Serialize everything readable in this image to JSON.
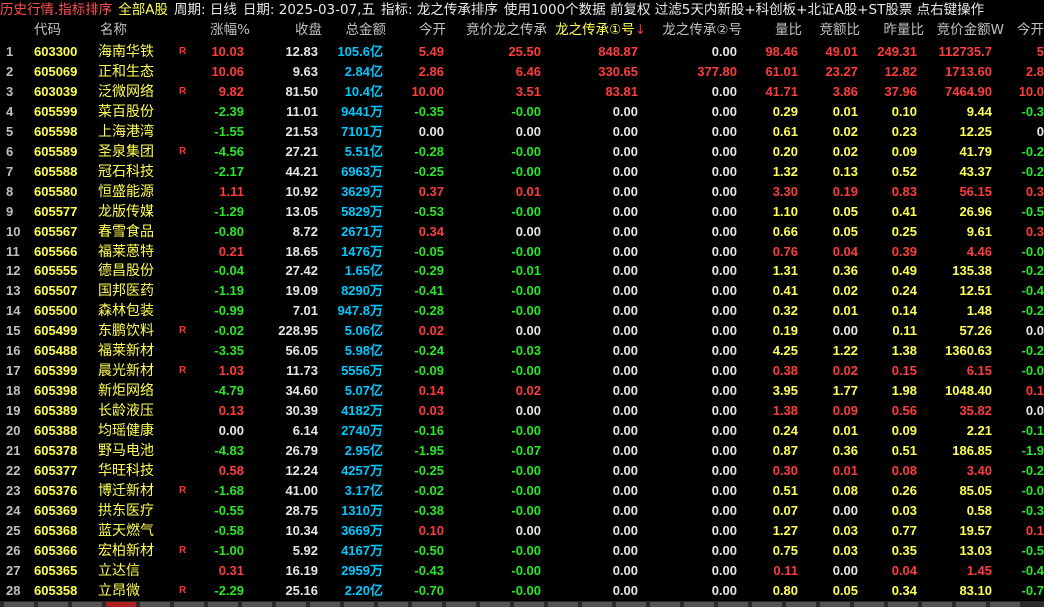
{
  "topbar": [
    {
      "text": "历史行情.指标排序",
      "color": "title"
    },
    {
      "text": "全部A股",
      "color": "y"
    },
    {
      "text": "周期: 日线",
      "color": "w"
    },
    {
      "text": "日期: 2025-03-07,五",
      "color": "w"
    },
    {
      "text": "指标: 龙之传承排序",
      "color": "w"
    },
    {
      "text": "使用1000个数据 前复权 过滤5天内新股+科创板+北证A股+ST股票 点右键操作",
      "color": "w"
    }
  ],
  "columns": [
    "",
    "代码",
    "名称",
    "涨幅%",
    "收盘",
    "总金额",
    "今开",
    "竞价龙之传承",
    "龙之传承①号",
    "龙之传承②号",
    "量比",
    "竞额比",
    "昨量比",
    "竞价金额W",
    "今开"
  ],
  "sorted_arrow": "↓",
  "rows": [
    {
      "seq": "1",
      "code": "603300",
      "name": "海南华铁",
      "flag": "R",
      "chg": "10.03",
      "close": "12.83",
      "amt": "105.6亿",
      "open": "5.49",
      "bid": "25.50",
      "l1": "848.87",
      "l2": "0.00",
      "vr": "98.46",
      "bar": "49.01",
      "yvr": "249.31",
      "bamt": "112735.7",
      "open2": "5"
    },
    {
      "seq": "2",
      "code": "605069",
      "name": "正和生态",
      "flag": "",
      "chg": "10.06",
      "close": "9.63",
      "amt": "2.84亿",
      "open": "2.86",
      "bid": "6.46",
      "l1": "330.65",
      "l2": "377.80",
      "vr": "61.01",
      "bar": "23.27",
      "yvr": "12.82",
      "bamt": "1713.60",
      "open2": "2.8"
    },
    {
      "seq": "3",
      "code": "603039",
      "name": "泛微网络",
      "flag": "R",
      "chg": "9.82",
      "close": "81.50",
      "amt": "10.4亿",
      "open": "10.00",
      "bid": "3.51",
      "l1": "83.81",
      "l2": "0.00",
      "vr": "41.71",
      "bar": "3.86",
      "yvr": "37.96",
      "bamt": "7464.90",
      "open2": "10.0"
    },
    {
      "seq": "4",
      "code": "605599",
      "name": "菜百股份",
      "flag": "",
      "chg": "-2.39",
      "close": "11.01",
      "amt": "9441万",
      "open": "-0.35",
      "bid": "-0.00",
      "l1": "0.00",
      "l2": "0.00",
      "vr": "0.29",
      "bar": "0.01",
      "yvr": "0.10",
      "bamt": "9.44",
      "open2": "-0.3"
    },
    {
      "seq": "5",
      "code": "605598",
      "name": "上海港湾",
      "flag": "",
      "chg": "-1.55",
      "close": "21.53",
      "amt": "7101万",
      "open": "0.00",
      "bid": "0.00",
      "l1": "0.00",
      "l2": "0.00",
      "vr": "0.61",
      "bar": "0.02",
      "yvr": "0.23",
      "bamt": "12.25",
      "open2": "0"
    },
    {
      "seq": "6",
      "code": "605589",
      "name": "圣泉集团",
      "flag": "R",
      "chg": "-4.56",
      "close": "27.21",
      "amt": "5.51亿",
      "open": "-0.28",
      "bid": "-0.00",
      "l1": "0.00",
      "l2": "0.00",
      "vr": "0.20",
      "bar": "0.02",
      "yvr": "0.09",
      "bamt": "41.79",
      "open2": "-0.2"
    },
    {
      "seq": "7",
      "code": "605588",
      "name": "冠石科技",
      "flag": "",
      "chg": "-2.17",
      "close": "44.21",
      "amt": "6963万",
      "open": "-0.25",
      "bid": "-0.00",
      "l1": "0.00",
      "l2": "0.00",
      "vr": "1.32",
      "bar": "0.13",
      "yvr": "0.52",
      "bamt": "43.37",
      "open2": "-0.2"
    },
    {
      "seq": "8",
      "code": "605580",
      "name": "恒盛能源",
      "flag": "",
      "chg": "1.11",
      "close": "10.92",
      "amt": "3629万",
      "open": "0.37",
      "bid": "0.01",
      "l1": "0.00",
      "l2": "0.00",
      "vr": "3.30",
      "bar": "0.19",
      "yvr": "0.83",
      "bamt": "56.15",
      "open2": "0.3"
    },
    {
      "seq": "9",
      "code": "605577",
      "name": "龙版传媒",
      "flag": "",
      "chg": "-1.29",
      "close": "13.05",
      "amt": "5829万",
      "open": "-0.53",
      "bid": "-0.00",
      "l1": "0.00",
      "l2": "0.00",
      "vr": "1.10",
      "bar": "0.05",
      "yvr": "0.41",
      "bamt": "26.96",
      "open2": "-0.5"
    },
    {
      "seq": "10",
      "code": "605567",
      "name": "春雪食品",
      "flag": "",
      "chg": "-0.80",
      "close": "8.72",
      "amt": "2671万",
      "open": "0.34",
      "bid": "0.00",
      "l1": "0.00",
      "l2": "0.00",
      "vr": "0.66",
      "bar": "0.05",
      "yvr": "0.25",
      "bamt": "9.61",
      "open2": "0.3"
    },
    {
      "seq": "11",
      "code": "605566",
      "name": "福莱蒽特",
      "flag": "",
      "chg": "0.21",
      "close": "18.65",
      "amt": "1476万",
      "open": "-0.05",
      "bid": "-0.00",
      "l1": "0.00",
      "l2": "0.00",
      "vr": "0.76",
      "bar": "0.04",
      "yvr": "0.39",
      "bamt": "4.46",
      "open2": "-0.0"
    },
    {
      "seq": "12",
      "code": "605555",
      "name": "德昌股份",
      "flag": "",
      "chg": "-0.04",
      "close": "27.42",
      "amt": "1.65亿",
      "open": "-0.29",
      "bid": "-0.01",
      "l1": "0.00",
      "l2": "0.00",
      "vr": "1.31",
      "bar": "0.36",
      "yvr": "0.49",
      "bamt": "135.38",
      "open2": "-0.2"
    },
    {
      "seq": "13",
      "code": "605507",
      "name": "国邦医药",
      "flag": "",
      "chg": "-1.19",
      "close": "19.09",
      "amt": "8290万",
      "open": "-0.41",
      "bid": "-0.00",
      "l1": "0.00",
      "l2": "0.00",
      "vr": "0.41",
      "bar": "0.02",
      "yvr": "0.24",
      "bamt": "12.51",
      "open2": "-0.4"
    },
    {
      "seq": "14",
      "code": "605500",
      "name": "森林包装",
      "flag": "",
      "chg": "-0.99",
      "close": "7.01",
      "amt": "947.8万",
      "open": "-0.28",
      "bid": "-0.00",
      "l1": "0.00",
      "l2": "0.00",
      "vr": "0.32",
      "bar": "0.01",
      "yvr": "0.14",
      "bamt": "1.48",
      "open2": "-0.2"
    },
    {
      "seq": "15",
      "code": "605499",
      "name": "东鹏饮料",
      "flag": "R",
      "chg": "-0.02",
      "close": "228.95",
      "amt": "5.06亿",
      "open": "0.02",
      "bid": "0.00",
      "l1": "0.00",
      "l2": "0.00",
      "vr": "0.19",
      "bar": "0.00",
      "yvr": "0.11",
      "bamt": "57.26",
      "open2": "0.0"
    },
    {
      "seq": "16",
      "code": "605488",
      "name": "福莱新材",
      "flag": "",
      "chg": "-3.35",
      "close": "56.05",
      "amt": "5.98亿",
      "open": "-0.24",
      "bid": "-0.03",
      "l1": "0.00",
      "l2": "0.00",
      "vr": "4.25",
      "bar": "1.22",
      "yvr": "1.38",
      "bamt": "1360.63",
      "open2": "-0.2"
    },
    {
      "seq": "17",
      "code": "605399",
      "name": "晨光新材",
      "flag": "R",
      "chg": "1.03",
      "close": "11.73",
      "amt": "5556万",
      "open": "-0.09",
      "bid": "-0.00",
      "l1": "0.00",
      "l2": "0.00",
      "vr": "0.38",
      "bar": "0.02",
      "yvr": "0.15",
      "bamt": "6.15",
      "open2": "-0.0"
    },
    {
      "seq": "18",
      "code": "605398",
      "name": "新炬网络",
      "flag": "",
      "chg": "-4.79",
      "close": "34.60",
      "amt": "5.07亿",
      "open": "0.14",
      "bid": "0.02",
      "l1": "0.00",
      "l2": "0.00",
      "vr": "3.95",
      "bar": "1.77",
      "yvr": "1.98",
      "bamt": "1048.40",
      "open2": "0.1"
    },
    {
      "seq": "19",
      "code": "605389",
      "name": "长龄液压",
      "flag": "",
      "chg": "0.13",
      "close": "30.39",
      "amt": "4182万",
      "open": "0.03",
      "bid": "0.00",
      "l1": "0.00",
      "l2": "0.00",
      "vr": "1.38",
      "bar": "0.09",
      "yvr": "0.56",
      "bamt": "35.82",
      "open2": "0.0"
    },
    {
      "seq": "20",
      "code": "605388",
      "name": "均瑶健康",
      "flag": "",
      "chg": "0.00",
      "close": "6.14",
      "amt": "2740万",
      "open": "-0.16",
      "bid": "-0.00",
      "l1": "0.00",
      "l2": "0.00",
      "vr": "0.24",
      "bar": "0.01",
      "yvr": "0.09",
      "bamt": "2.21",
      "open2": "-0.1"
    },
    {
      "seq": "21",
      "code": "605378",
      "name": "野马电池",
      "flag": "",
      "chg": "-4.83",
      "close": "26.79",
      "amt": "2.95亿",
      "open": "-1.95",
      "bid": "-0.07",
      "l1": "0.00",
      "l2": "0.00",
      "vr": "0.87",
      "bar": "0.36",
      "yvr": "0.51",
      "bamt": "186.85",
      "open2": "-1.9"
    },
    {
      "seq": "22",
      "code": "605377",
      "name": "华旺科技",
      "flag": "",
      "chg": "0.58",
      "close": "12.24",
      "amt": "4257万",
      "open": "-0.25",
      "bid": "-0.00",
      "l1": "0.00",
      "l2": "0.00",
      "vr": "0.30",
      "bar": "0.01",
      "yvr": "0.08",
      "bamt": "3.40",
      "open2": "-0.2"
    },
    {
      "seq": "23",
      "code": "605376",
      "name": "博迁新材",
      "flag": "R",
      "chg": "-1.68",
      "close": "41.00",
      "amt": "3.17亿",
      "open": "-0.02",
      "bid": "-0.00",
      "l1": "0.00",
      "l2": "0.00",
      "vr": "0.51",
      "bar": "0.08",
      "yvr": "0.26",
      "bamt": "85.05",
      "open2": "-0.0"
    },
    {
      "seq": "24",
      "code": "605369",
      "name": "拱东医疗",
      "flag": "",
      "chg": "-0.55",
      "close": "28.75",
      "amt": "1310万",
      "open": "-0.38",
      "bid": "-0.00",
      "l1": "0.00",
      "l2": "0.00",
      "vr": "0.07",
      "bar": "0.00",
      "yvr": "0.03",
      "bamt": "0.58",
      "open2": "-0.3"
    },
    {
      "seq": "25",
      "code": "605368",
      "name": "蓝天燃气",
      "flag": "",
      "chg": "-0.58",
      "close": "10.34",
      "amt": "3669万",
      "open": "0.10",
      "bid": "0.00",
      "l1": "0.00",
      "l2": "0.00",
      "vr": "1.27",
      "bar": "0.03",
      "yvr": "0.77",
      "bamt": "19.57",
      "open2": "0.1"
    },
    {
      "seq": "26",
      "code": "605366",
      "name": "宏柏新材",
      "flag": "R",
      "chg": "-1.00",
      "close": "5.92",
      "amt": "4167万",
      "open": "-0.50",
      "bid": "-0.00",
      "l1": "0.00",
      "l2": "0.00",
      "vr": "0.75",
      "bar": "0.03",
      "yvr": "0.35",
      "bamt": "13.03",
      "open2": "-0.5"
    },
    {
      "seq": "27",
      "code": "605365",
      "name": "立达信",
      "flag": "",
      "chg": "0.31",
      "close": "16.19",
      "amt": "2959万",
      "open": "-0.43",
      "bid": "-0.00",
      "l1": "0.00",
      "l2": "0.00",
      "vr": "0.11",
      "bar": "0.00",
      "yvr": "0.04",
      "bamt": "1.45",
      "open2": "-0.4"
    },
    {
      "seq": "28",
      "code": "605358",
      "name": "立昂微",
      "flag": "R",
      "chg": "-2.29",
      "close": "25.16",
      "amt": "2.20亿",
      "open": "-0.70",
      "bid": "-0.00",
      "l1": "0.00",
      "l2": "0.00",
      "vr": "0.80",
      "bar": "0.05",
      "yvr": "0.34",
      "bamt": "83.10",
      "open2": "-0.7"
    }
  ]
}
